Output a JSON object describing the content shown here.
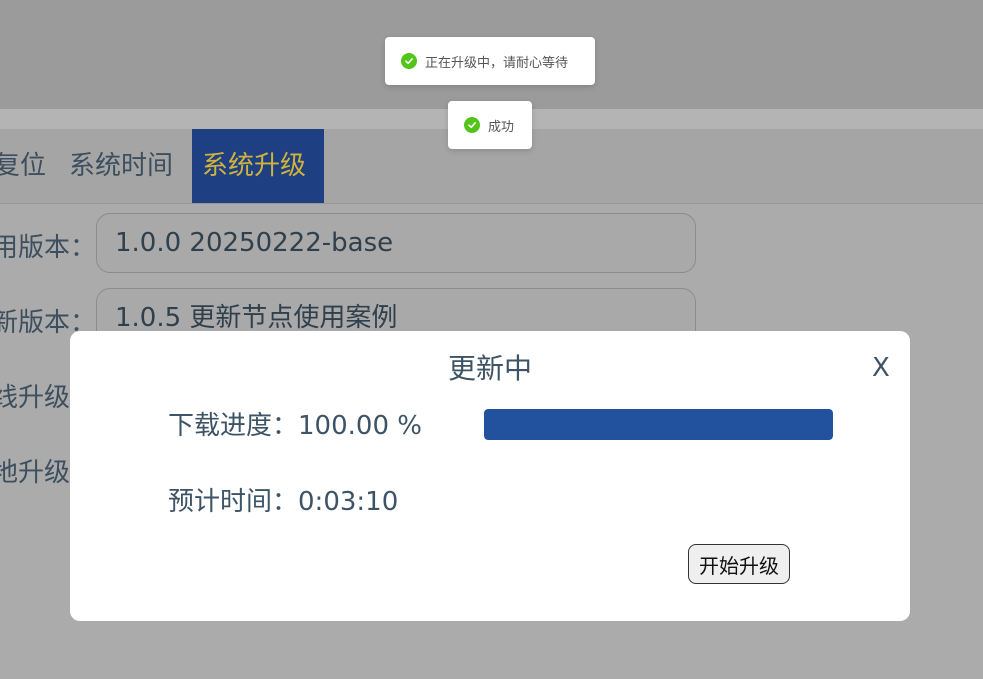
{
  "toasts": [
    {
      "text": "正在升级中，请耐心等待",
      "icon": "check-circle-icon"
    },
    {
      "text": "成功",
      "icon": "check-circle-icon"
    }
  ],
  "tabs": {
    "reset": "复位",
    "time": "系统时间",
    "upgrade": "系统升级"
  },
  "form": {
    "current_label": "用版本：",
    "current_value": "1.0.0 20250222-base",
    "latest_label": "新版本：",
    "latest_value": "1.0.5 更新节点使用案例",
    "online_label": "线升级",
    "local_label": "地升级"
  },
  "modal": {
    "title": "更新中",
    "close": "X",
    "progress_label": "下载进度：",
    "progress_value": "100.00 %",
    "progress_fraction": 1.0,
    "time_label": "预计时间：",
    "time_value": "0:03:10",
    "start_button": "开始升级"
  },
  "colors": {
    "active_tab_bg": "#1f3f83",
    "active_tab_text": "#cfb33a",
    "progress_fill": "#22519e",
    "success": "#52c41a"
  }
}
